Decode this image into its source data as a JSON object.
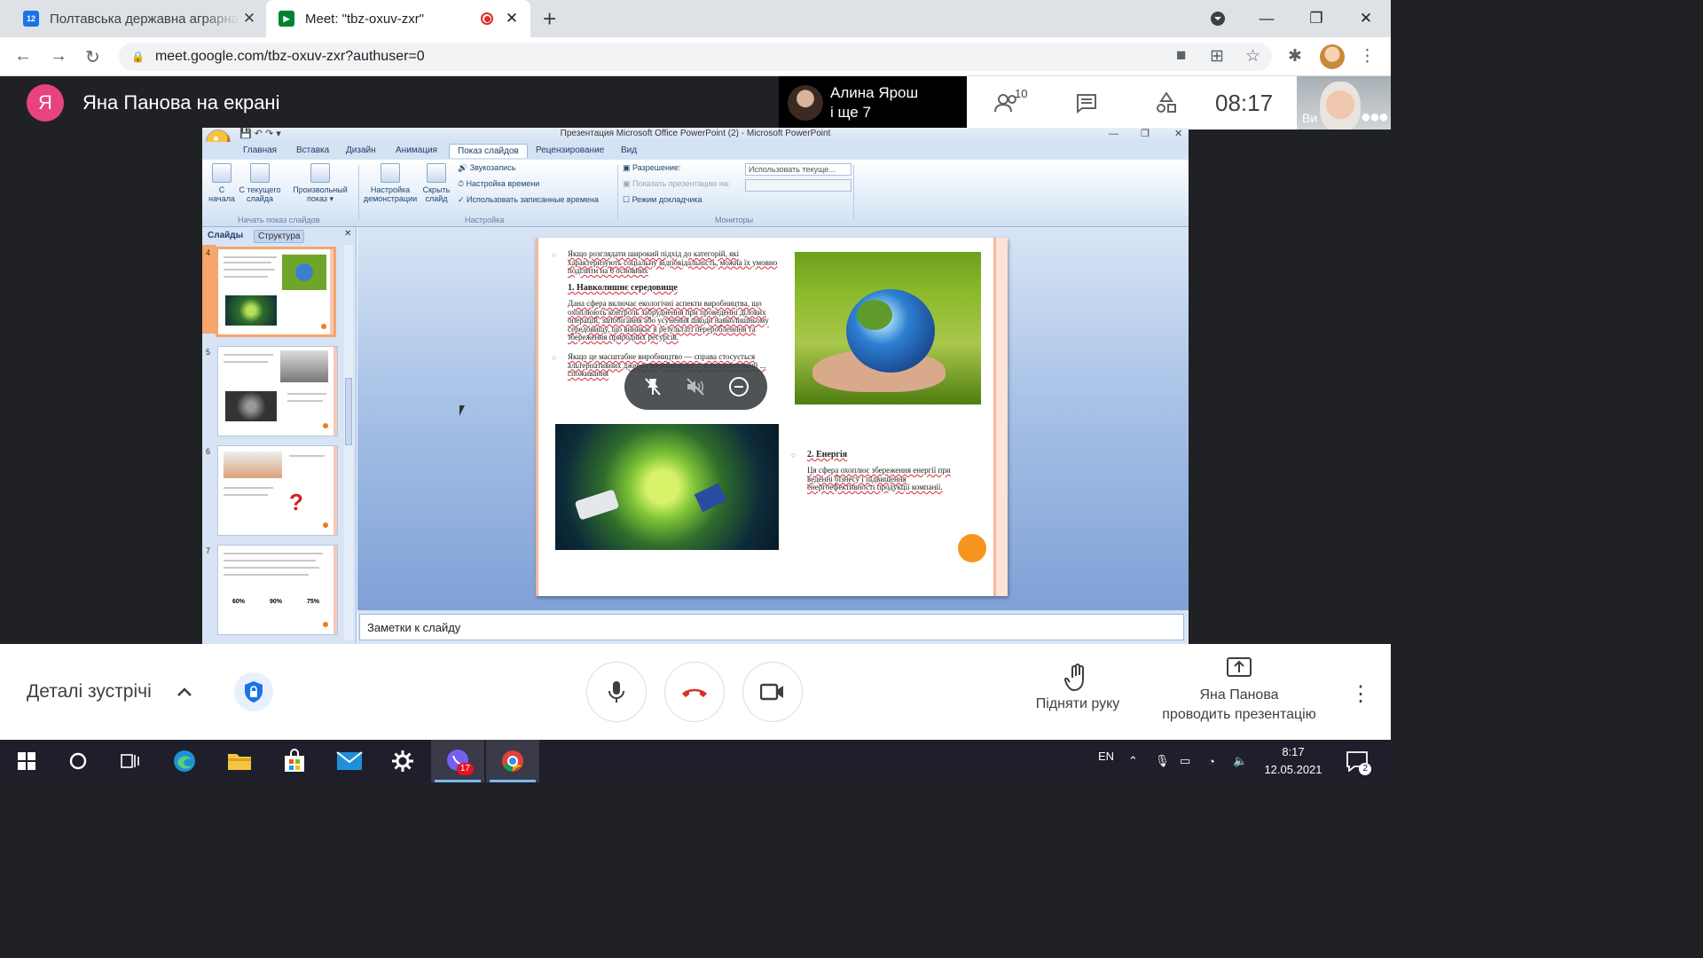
{
  "browser": {
    "tabs": [
      {
        "title": "Полтавська державна аграрна а",
        "favicon_text": "12",
        "favicon_color": "#1a73e8"
      },
      {
        "title": "Meet: \"tbz-oxuv-zxr\"",
        "favicon_color": "#00832d"
      }
    ],
    "url": "meet.google.com/tbz-oxuv-zxr?authuser=0"
  },
  "meet": {
    "presenter_initial": "Я",
    "presenting_label": "Яна Панова на екрані",
    "participant_name": "Алина Ярош",
    "participant_more": "і ще 7",
    "participants_count": "10",
    "time": "08:17",
    "self_label": "Ви"
  },
  "powerpoint": {
    "window_title": "Презентация Microsoft Office PowerPoint (2) - Microsoft PowerPoint",
    "tabs": [
      "Главная",
      "Вставка",
      "Дизайн",
      "Анимация",
      "Показ слайдов",
      "Рецензирование",
      "Вид"
    ],
    "ribbon": {
      "from_start": "С начала",
      "from_current": "С текущего слайда",
      "custom_show": "Произвольный показ ▾",
      "group_start": "Начать показ слайдов",
      "setup_show": "Настройка демонстрации",
      "hide_slide": "Скрыть слайд",
      "record_narration": "Звукозапись",
      "rehearse": "Настройка времени",
      "use_timings": "Использовать записанные времена",
      "group_setup": "Настройка",
      "resolution_label": "Разрешение:",
      "resolution_value": "Использовать текуще...",
      "show_on_label": "Показать презентацию на:",
      "presenter_view": "Режим докладчика",
      "group_monitors": "Мониторы"
    },
    "panel_tabs": [
      "Слайды",
      "Структура"
    ],
    "thumbnails": [
      {
        "number": "4"
      },
      {
        "number": "5"
      },
      {
        "number": "6"
      },
      {
        "number": "7",
        "stats": [
          "60%",
          "90%",
          "75%"
        ]
      }
    ],
    "slide": {
      "intro": "Якщо розглядати широкий підхід до категорій, які характеризують соціальну відповідальність, можна їх умовно поділити на 6 основних",
      "heading1": "1. Навколишнє середовище",
      "para1": "Дана сфера включає екологічні аспекти виробництва, що охоплюють контроль забруднення при проведенні ділових операцій, запобігання або усунення шкоди навколишньому середовищу, що виникає в результаті переробленння та збереження природних ресурсів.",
      "bullet2": "Якщо це масштабне виробництво — справа стосується альтернативних джерел виробництва ... консалтинговий ... споживання",
      "heading2": "2. Енергія",
      "para2": "Ця сфера охоплює збереження енергії при веденні бізнесу і підвищення енергоефективності продукції компанії."
    },
    "notes_placeholder": "Заметки к слайду"
  },
  "controls": {
    "meeting_details": "Деталі зустрічі",
    "raise_hand": "Підняти руку",
    "presenter_line1": "Яна Панова",
    "presenter_line2": "проводить презентацію"
  },
  "taskbar": {
    "viber_badge": "17",
    "language": "EN",
    "time": "8:17",
    "date": "12.05.2021",
    "notification_count": "2"
  },
  "colors": {
    "meet_dark": "#202124",
    "hangup_red": "#d93025",
    "accent_orange": "#f7941d",
    "avatar_pink": "#e8437f"
  }
}
